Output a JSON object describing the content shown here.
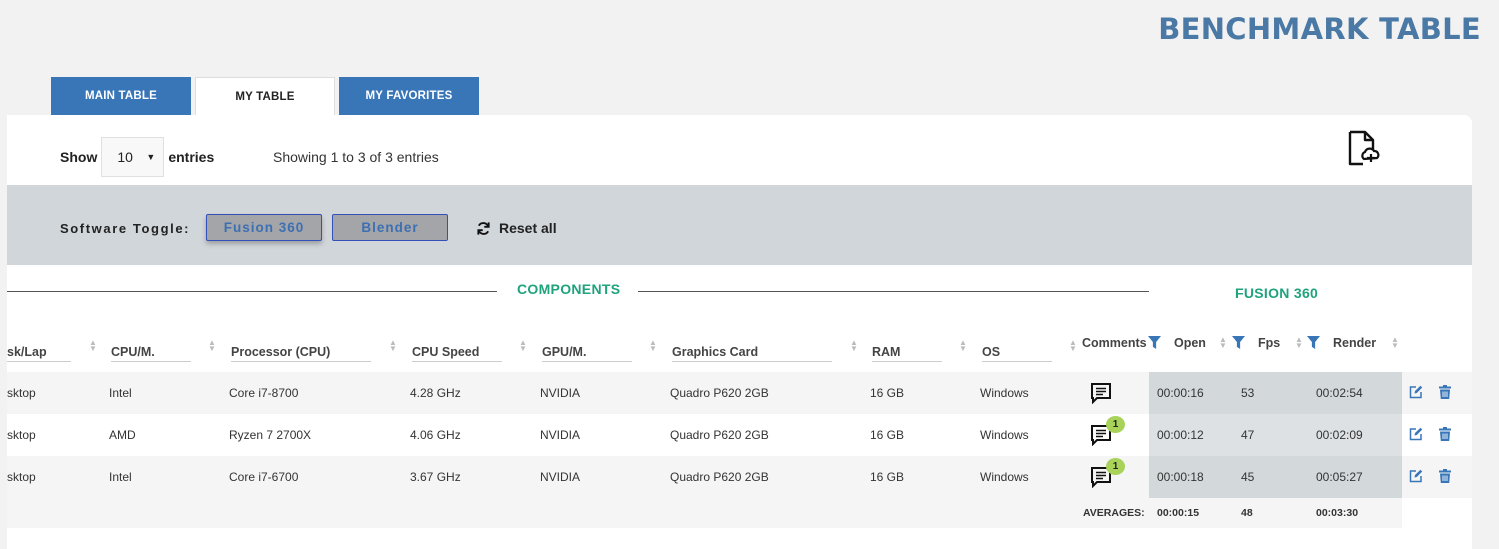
{
  "page": {
    "title": "BENCHMARK TABLE"
  },
  "tabs": [
    {
      "label": "MAIN TABLE"
    },
    {
      "label": "MY TABLE"
    },
    {
      "label": "MY FAVORITES"
    }
  ],
  "entries": {
    "show_label": "Show",
    "selected": "10",
    "suffix": "entries",
    "info": "Showing 1 to 3 of 3 entries"
  },
  "toggle": {
    "label": "Software Toggle:",
    "fusion": "Fusion 360",
    "blender": "Blender",
    "reset": "Reset all"
  },
  "groups": {
    "components": "COMPONENTS",
    "fusion": "FUSION 360"
  },
  "columns": {
    "desk_lap": "sk/Lap",
    "cpu_m": "CPU/M.",
    "processor": "Processor (CPU)",
    "cpu_speed": "CPU Speed",
    "gpu_m": "GPU/M.",
    "graphics": "Graphics Card",
    "ram": "RAM",
    "os": "OS",
    "comments": "Comments",
    "open": "Open",
    "fps": "Fps",
    "render": "Render"
  },
  "rows": [
    {
      "type": "sktop",
      "cpu_m": "Intel",
      "processor": "Core i7-8700",
      "speed": "4.28 GHz",
      "gpu_m": "NVIDIA",
      "graphics": "Quadro P620 2GB",
      "ram": "16 GB",
      "os": "Windows",
      "comments": "",
      "open": "00:00:16",
      "fps": "53",
      "render": "00:02:54"
    },
    {
      "type": "sktop",
      "cpu_m": "AMD",
      "processor": "Ryzen 7 2700X",
      "speed": "4.06 GHz",
      "gpu_m": "NVIDIA",
      "graphics": "Quadro P620 2GB",
      "ram": "16 GB",
      "os": "Windows",
      "comments": "1",
      "open": "00:00:12",
      "fps": "47",
      "render": "00:02:09"
    },
    {
      "type": "sktop",
      "cpu_m": "Intel",
      "processor": "Core i7-6700",
      "speed": "3.67 GHz",
      "gpu_m": "NVIDIA",
      "graphics": "Quadro P620 2GB",
      "ram": "16 GB",
      "os": "Windows",
      "comments": "1",
      "open": "00:00:18",
      "fps": "45",
      "render": "00:05:27"
    }
  ],
  "averages": {
    "label": "AVERAGES:",
    "open": "00:00:15",
    "fps": "48",
    "render": "00:03:30"
  },
  "colors": {
    "accent_blue": "#3876b8",
    "title_blue": "#4a79a5",
    "green": "#1fa37d",
    "badge": "#a9d25a"
  }
}
